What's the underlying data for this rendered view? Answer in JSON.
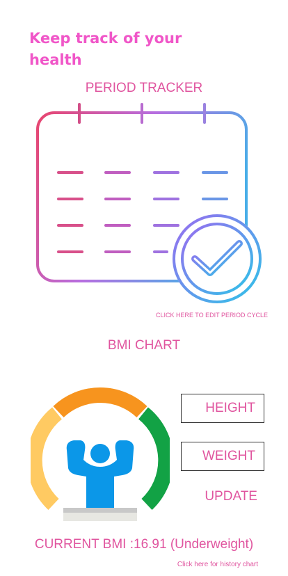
{
  "header": {
    "title": "Keep track of your health"
  },
  "period": {
    "label": "PERIOD TRACKER",
    "edit_link": "CLICK HERE TO EDIT PERIOD CYCLE",
    "icon": "calendar-check-icon"
  },
  "bmi": {
    "label": "BMI CHART",
    "icon": "bmi-gauge-icon",
    "height_placeholder": "HEIGHT",
    "weight_placeholder": "WEIGHT",
    "update_label": "UPDATE",
    "current": "CURRENT BMI :16.91 (Underweight)",
    "history_link": "Click here for history chart"
  },
  "colors": {
    "accent_pink": "#e0559f",
    "title_pink": "#f056c8",
    "gauge_yellow": "#ffca62",
    "gauge_orange": "#f7941e",
    "gauge_green": "#12a245",
    "figure_blue": "#0b97e8"
  }
}
